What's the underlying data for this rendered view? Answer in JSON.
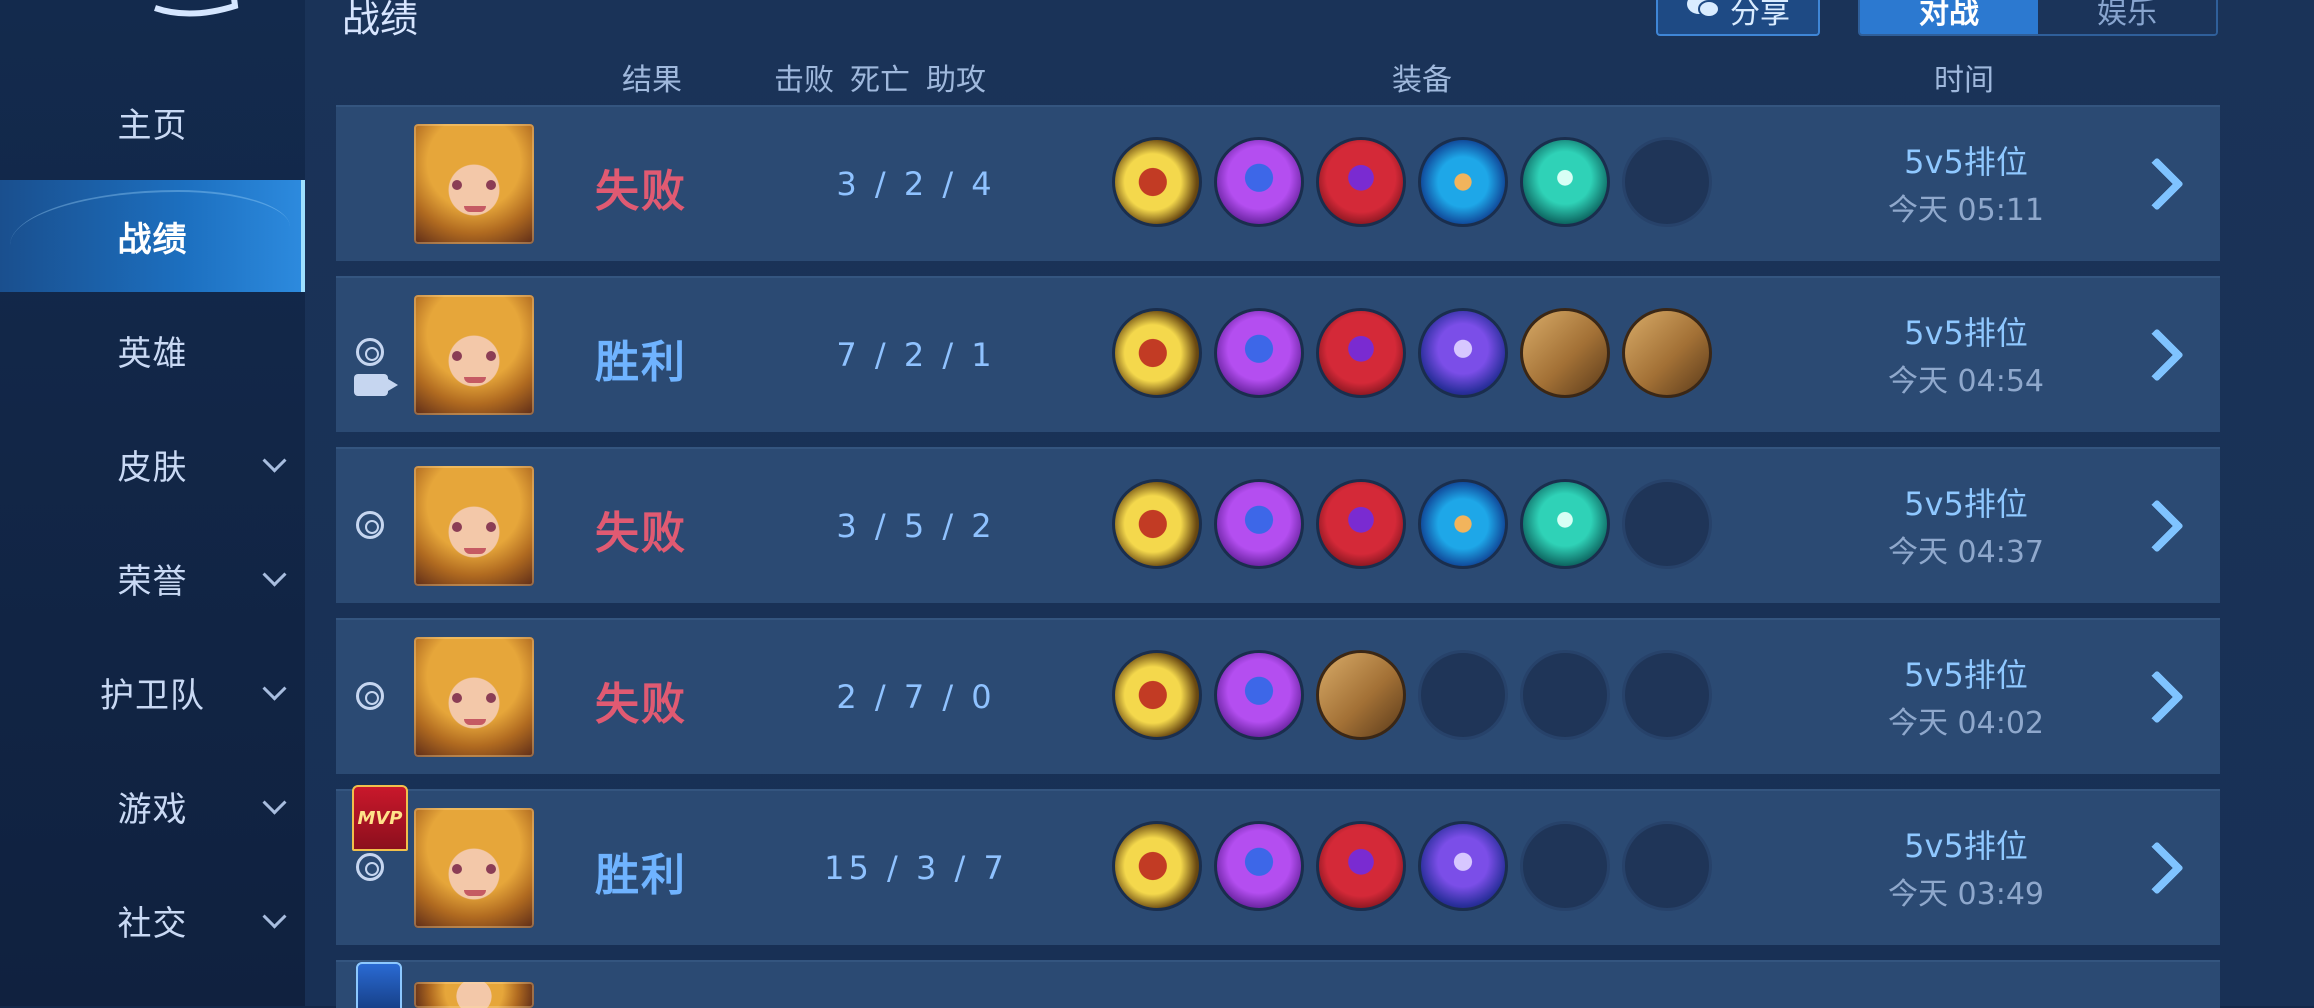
{
  "sidebar": {
    "items": [
      {
        "label": "主页",
        "active": false,
        "has_chevron": false
      },
      {
        "label": "战绩",
        "active": true,
        "has_chevron": false
      },
      {
        "label": "英雄",
        "active": false,
        "has_chevron": false
      },
      {
        "label": "皮肤",
        "active": false,
        "has_chevron": true
      },
      {
        "label": "荣誉",
        "active": false,
        "has_chevron": true
      },
      {
        "label": "护卫队",
        "active": false,
        "has_chevron": true
      },
      {
        "label": "游戏",
        "active": false,
        "has_chevron": true
      },
      {
        "label": "社交",
        "active": false,
        "has_chevron": true
      }
    ]
  },
  "header": {
    "title": "战绩",
    "share_label": "分享",
    "tabs": [
      {
        "label": "对战",
        "active": true
      },
      {
        "label": "娱乐",
        "active": false
      }
    ]
  },
  "columns": {
    "result": "结果",
    "kills": "击败",
    "deaths": "死亡",
    "assists": "助攻",
    "equipment": "装备",
    "time": "时间"
  },
  "matches": [
    {
      "result": "失败",
      "outcome": "lose",
      "kda": "3 / 2 / 4",
      "items": [
        "boots-icon",
        "mage-icon",
        "hat-icon",
        "orb-icon",
        "crystal-icon",
        "empty"
      ],
      "mode": "5v5排位",
      "time": "今天 05:11",
      "replay": false,
      "video": false,
      "mvp": false
    },
    {
      "result": "胜利",
      "outcome": "win",
      "kda": "7 / 2 / 1",
      "items": [
        "boots-icon",
        "mage-icon",
        "hat-icon",
        "staff-icon",
        "book-icon",
        "book-icon"
      ],
      "mode": "5v5排位",
      "time": "今天 04:54",
      "replay": true,
      "video": true,
      "mvp": false
    },
    {
      "result": "失败",
      "outcome": "lose",
      "kda": "3 / 5 / 2",
      "items": [
        "boots-icon",
        "mage-icon",
        "hat-icon",
        "orb-icon",
        "crystal-icon",
        "empty"
      ],
      "mode": "5v5排位",
      "time": "今天 04:37",
      "replay": true,
      "video": false,
      "mvp": false
    },
    {
      "result": "失败",
      "outcome": "lose",
      "kda": "2 / 7 / 0",
      "items": [
        "boots-icon",
        "mage-icon",
        "book-icon",
        "empty",
        "empty",
        "empty"
      ],
      "mode": "5v5排位",
      "time": "今天 04:02",
      "replay": true,
      "video": false,
      "mvp": false
    },
    {
      "result": "胜利",
      "outcome": "win",
      "kda": "15 / 3 / 7",
      "items": [
        "boots-icon",
        "mage-icon",
        "hat-icon",
        "staff-icon",
        "empty",
        "empty"
      ],
      "mode": "5v5排位",
      "time": "今天 03:49",
      "replay": true,
      "video": false,
      "mvp": true,
      "mvp_label": "MVP"
    }
  ],
  "colors": {
    "win": "#6fb3ff",
    "lose": "#e05a72",
    "active_tab": "#2c79d0",
    "row_bg": "#2b4a73"
  }
}
